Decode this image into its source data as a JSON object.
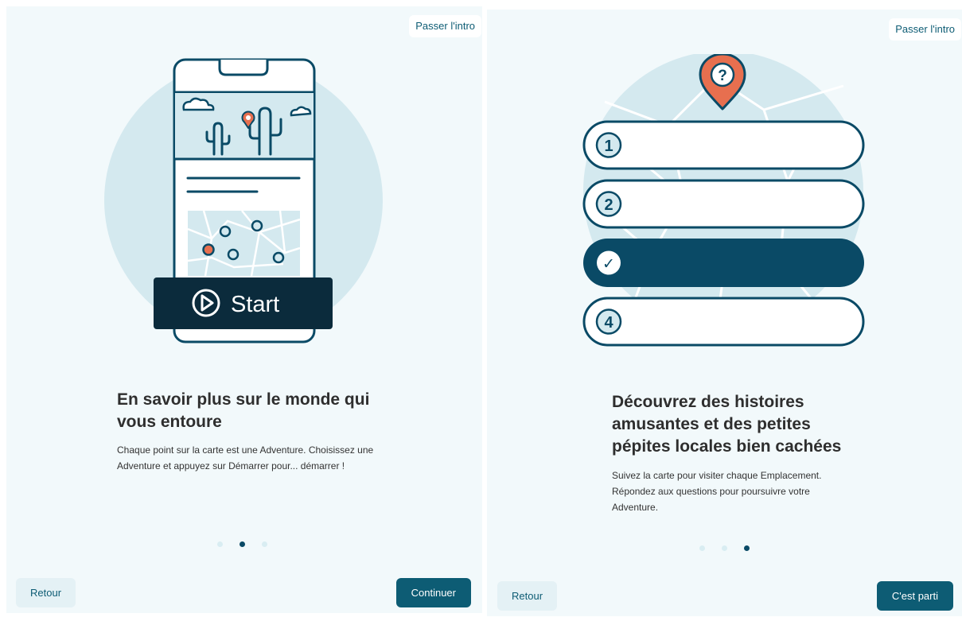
{
  "slides": [
    {
      "skip_label": "Passer l'intro",
      "illustration": {
        "start_label": "Start"
      },
      "title": "En savoir plus sur le monde qui vous entoure",
      "body": "Chaque point sur la carte est une Adventure. Choisissez une Adventure et appuyez sur Démarrer pour... démarrer !",
      "back_label": "Retour",
      "next_label": "Continuer",
      "dots": {
        "count": 3,
        "active_index": 1
      }
    },
    {
      "skip_label": "Passer l'intro",
      "illustration": {
        "pin_symbol": "?",
        "options": [
          "1",
          "2",
          "✓",
          "4"
        ],
        "selected_index": 2
      },
      "title": "Découvrez des histoires amusantes et des petites pépites locales bien cachées",
      "body": "Suivez la carte pour visiter chaque Emplacement. Répondez aux questions pour poursuivre votre Adventure.",
      "back_label": "Retour",
      "next_label": "C'est parti",
      "dots": {
        "count": 3,
        "active_index": 2
      }
    }
  ],
  "colors": {
    "background": "#f2f9fb",
    "primary": "#0d5c74",
    "illustration_dark": "#0a4a66",
    "illustration_circle": "#d4e9ef",
    "accent_pin": "#e76f4f",
    "start_banner": "#0b2b3c"
  }
}
